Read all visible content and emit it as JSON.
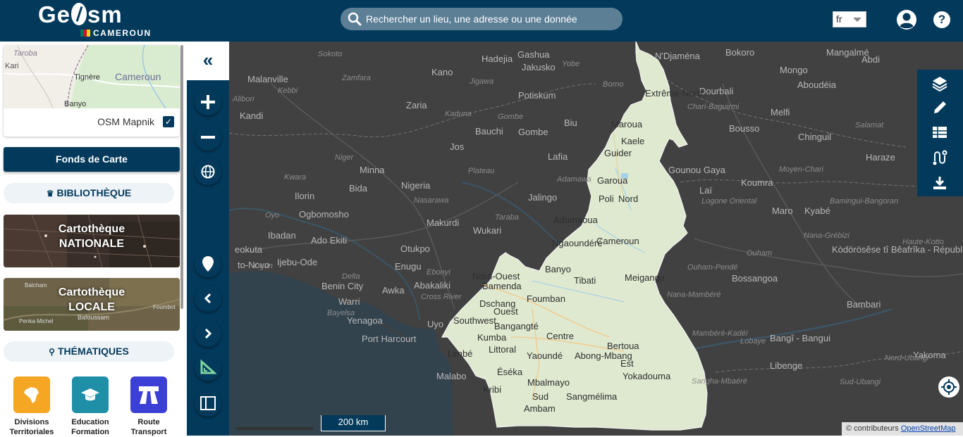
{
  "header": {
    "logo_text_left": "Ge",
    "logo_text_right": "sm",
    "logo_country": "CAMEROUN",
    "search_placeholder": "Rechercher un lieu, une adresse ou une donnée",
    "language": "fr",
    "colors": {
      "primary": "#033a5c",
      "search_bg": "#5c7f96"
    }
  },
  "sidebar": {
    "basemap_thumb_labels": [
      "Taroba",
      "Kari",
      "Tignère",
      "Cameroun",
      "Banyo"
    ],
    "basemap_name": "OSM Mapnik",
    "basemap_checked": true,
    "fonds_button": "Fonds de Carte",
    "bibliotheque_title": "BIBLIOTHÈQUE",
    "catalogs": [
      {
        "line1": "Cartothèque",
        "line2": "NATIONALE"
      },
      {
        "line1": "Cartothèque",
        "line2": "LOCALE",
        "thumb_labels": [
          "Batcham",
          "Foumbot",
          "Penka-Michel",
          "Bafoussam"
        ]
      }
    ],
    "thematiques_title": "THÉMATIQUES",
    "themes": [
      {
        "line1": "Divisions",
        "line2": "Territoriales",
        "color": "#f5a623",
        "icon": "africa-map-icon"
      },
      {
        "line1": "Education",
        "line2": "Formation",
        "color": "#1e8fa6",
        "icon": "graduation-cap-icon"
      },
      {
        "line1": "Route",
        "line2": "Transport",
        "color": "#3b3fd6",
        "icon": "road-icon"
      }
    ]
  },
  "toolbar": {
    "collapse_icon": "double-chevron-left-icon",
    "buttons": [
      "zoom-in-icon",
      "zoom-out-icon",
      "globe-icon",
      "map-marker-icon",
      "chevron-left-icon",
      "chevron-right-icon",
      "measure-icon",
      "sidebar-toggle-icon"
    ]
  },
  "map": {
    "labels_dark": [
      [
        "Malanville",
        26,
        46
      ],
      [
        "Kandi",
        15,
        98
      ],
      [
        "Kano",
        287,
        36
      ],
      [
        "Hadejia",
        358,
        17
      ],
      [
        "Gashua",
        409,
        11
      ],
      [
        "Jakusko",
        415,
        29
      ],
      [
        "Potiskum",
        410,
        69
      ],
      [
        "Zaria",
        251,
        83
      ],
      [
        "Bauchi",
        349,
        120
      ],
      [
        "Gombe",
        410,
        121
      ],
      [
        "Biu",
        475,
        108
      ],
      [
        "Jos",
        313,
        142
      ],
      [
        "Lafia",
        452,
        156
      ],
      [
        "Minna",
        185,
        175
      ],
      [
        "Bida",
        170,
        201
      ],
      [
        "Nigeria",
        244,
        197
      ],
      [
        "Ilorin",
        93,
        212
      ],
      [
        "Jalingo",
        424,
        214
      ],
      [
        "Ogbomosho",
        99,
        238
      ],
      [
        "Makurdi",
        280,
        250
      ],
      [
        "Wukari",
        346,
        261
      ],
      [
        "Ibadan",
        55,
        268
      ],
      [
        "Ado Ekiti",
        116,
        275
      ],
      [
        "Otukpo",
        243,
        287
      ],
      [
        "eokuta",
        8,
        288
      ],
      [
        "Ijebu-Ode",
        68,
        306
      ],
      [
        "Enugu",
        235,
        312
      ],
      [
        "to-Novo",
        12,
        310
      ],
      [
        "Benin City",
        131,
        340
      ],
      [
        "Abakaliki",
        262,
        339
      ],
      [
        "Awka",
        217,
        346
      ],
      [
        "Warri",
        155,
        362
      ],
      [
        "Yenagoa",
        167,
        389
      ],
      [
        "Uyo",
        281,
        394
      ],
      [
        "Port Harcourt",
        188,
        415
      ],
      [
        "Malabo",
        294,
        468
      ],
      [
        "N'Djaména",
        604,
        13
      ],
      [
        "Bokoro",
        704,
        8
      ],
      [
        "Mongo",
        781,
        33
      ],
      [
        "Mangalmé",
        847,
        8
      ],
      [
        "Abdi",
        897,
        18
      ],
      [
        "Dourbali",
        667,
        63
      ],
      [
        "Aboudéia",
        806,
        54
      ],
      [
        "Melfi",
        768,
        93
      ],
      [
        "Bousso",
        709,
        116
      ],
      [
        "Chinguil",
        807,
        128
      ],
      [
        "Haraze",
        903,
        157
      ],
      [
        "Gounou Gaya",
        623,
        175
      ],
      [
        "Koumra",
        726,
        193
      ],
      [
        "Laï",
        667,
        204
      ],
      [
        "Maro",
        770,
        233
      ],
      [
        "Kyabé",
        816,
        233
      ],
      [
        "Kòdörösêse tî Bêafrîka - République Centrafricaine",
        855,
        288
      ],
      [
        "Bossangoa",
        713,
        329
      ],
      [
        "Bambari",
        876,
        366
      ],
      [
        "Bangî - Bangui",
        767,
        414
      ],
      [
        "Yakoma",
        970,
        438
      ],
      [
        "Libenge",
        767,
        453
      ]
    ],
    "labels_italic": [
      [
        "Sokoto",
        126,
        12
      ],
      [
        "Zamfara",
        160,
        46
      ],
      [
        "Jigawa",
        341,
        51
      ],
      [
        "Yobe",
        472,
        26
      ],
      [
        "Kebbi",
        69,
        64
      ],
      [
        "Alibori",
        5,
        76
      ],
      [
        "Kaduna",
        306,
        97
      ],
      [
        "Borno",
        530,
        55
      ],
      [
        "Gombe",
        381,
        101
      ],
      [
        "Niger",
        150,
        159
      ],
      [
        "Plateau",
        339,
        178
      ],
      [
        "Kwara",
        78,
        187
      ],
      [
        "Adamawa",
        465,
        190
      ],
      [
        "Nasarawa",
        262,
        220
      ],
      [
        "Oyo",
        51,
        241
      ],
      [
        "Taraba",
        377,
        244
      ],
      [
        "Ogun",
        35,
        313
      ],
      [
        "Ebonyi",
        280,
        322
      ],
      [
        "Cross River",
        272,
        357
      ],
      [
        "Delta",
        160,
        328
      ],
      [
        "Bayelsa",
        139,
        380
      ],
      [
        "Chari-Baguirmi",
        650,
        87
      ],
      [
        "Salamat",
        888,
        113
      ],
      [
        "Moyen-Chari",
        780,
        176
      ],
      [
        "Bamingui-Bangoran",
        852,
        221
      ],
      [
        "Logone Oriental",
        670,
        221
      ],
      [
        "Ouham",
        734,
        295
      ],
      [
        "Ouham-Pendé",
        650,
        315
      ],
      [
        "Nana-Grébizi",
        815,
        270
      ],
      [
        "Haute-Kotto",
        955,
        279
      ],
      [
        "Nana-Mambéré",
        621,
        354
      ],
      [
        "Mambéré-Kadéï",
        657,
        409
      ],
      [
        "Sangha-Mbaéré",
        656,
        477
      ],
      [
        "Nord-Ubangi",
        930,
        444
      ],
      [
        "Sud-Ubangi",
        866,
        478
      ],
      [
        "Lobaye",
        725,
        420
      ]
    ],
    "labels_country": [
      [
        "Maroua",
        542,
        110
      ],
      [
        "Kaele",
        556,
        134
      ],
      [
        "Guider",
        532,
        151
      ],
      [
        "Garoua",
        522,
        190
      ],
      [
        "Poli",
        524,
        216
      ],
      [
        "Nord",
        552,
        216
      ],
      [
        "Cameroun",
        521,
        276
      ],
      [
        "Ngaoundéré",
        458,
        279
      ],
      [
        "Banyo",
        448,
        316
      ],
      [
        "Tibati",
        489,
        332
      ],
      [
        "Meiganga",
        561,
        328
      ],
      [
        "Bamenda",
        359,
        340
      ],
      [
        "Dschang",
        355,
        365
      ],
      [
        "Foumban",
        422,
        358
      ],
      [
        "Bangangté",
        376,
        397
      ],
      [
        "Kumba",
        352,
        413
      ],
      [
        "Yaoundé",
        422,
        439
      ],
      [
        "Abong-Mbang",
        490,
        439
      ],
      [
        "Bertoua",
        536,
        425
      ],
      [
        "Yokadouma",
        558,
        468
      ],
      [
        "Mbalmayo",
        423,
        477
      ],
      [
        "Sangmélima",
        478,
        497
      ],
      [
        "Éséka",
        380,
        462
      ],
      [
        "Kribi",
        360,
        487
      ],
      [
        "Ambam",
        418,
        514
      ],
      [
        "Limbé",
        310,
        436
      ],
      [
        "Extrême-Nord",
        590,
        66
      ],
      [
        "Adamaoua",
        460,
        246
      ],
      [
        "Nord-Ouest",
        345,
        326
      ],
      [
        "Ouest",
        375,
        376
      ],
      [
        "Southwest",
        318,
        389
      ],
      [
        "Centre",
        450,
        411
      ],
      [
        "Littoral",
        368,
        430
      ],
      [
        "Est",
        555,
        450
      ],
      [
        "Sud",
        430,
        497
      ]
    ]
  },
  "right_tools": [
    "layers-icon",
    "pencil-icon",
    "table-icon",
    "route-icon",
    "download-icon"
  ],
  "scale_label": "200 km",
  "attribution": {
    "prefix": "© contributeurs",
    "link": "OpenStreetMap"
  }
}
